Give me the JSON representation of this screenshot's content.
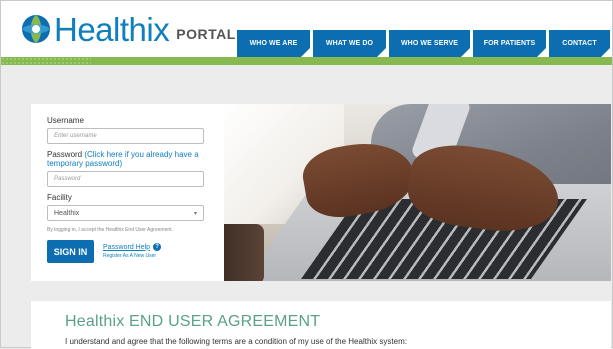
{
  "header": {
    "logo_text": "Healthix",
    "logo_suffix": "PORTAL",
    "logo_icon": "healthix-globe-icon",
    "nav": [
      {
        "label": "WHO WE ARE"
      },
      {
        "label": "WHAT WE DO"
      },
      {
        "label": "WHO WE SERVE"
      },
      {
        "label": "FOR PATIENTS"
      },
      {
        "label": "CONTACT"
      }
    ]
  },
  "login": {
    "username_label": "Username",
    "username_placeholder": "Enter username",
    "password_label": "Password",
    "password_link": "(Click here if you already have a temporary password)",
    "password_placeholder": "Password",
    "facility_label": "Facility",
    "facility_value": "Healthix",
    "disclaimer": "By logging in, I accept the Healthix End User Agreement.",
    "signin_label": "SIGN IN",
    "password_help_label": "Password Help",
    "register_label": "Register As A New User"
  },
  "agreement": {
    "title": "Healthix END USER AGREEMENT",
    "text": "I understand and agree that the following terms are a condition of my use of the Healthix system:"
  },
  "colors": {
    "brand_blue": "#0c6db1",
    "brand_green": "#86b94f",
    "agreement_title": "#5aa08b"
  }
}
